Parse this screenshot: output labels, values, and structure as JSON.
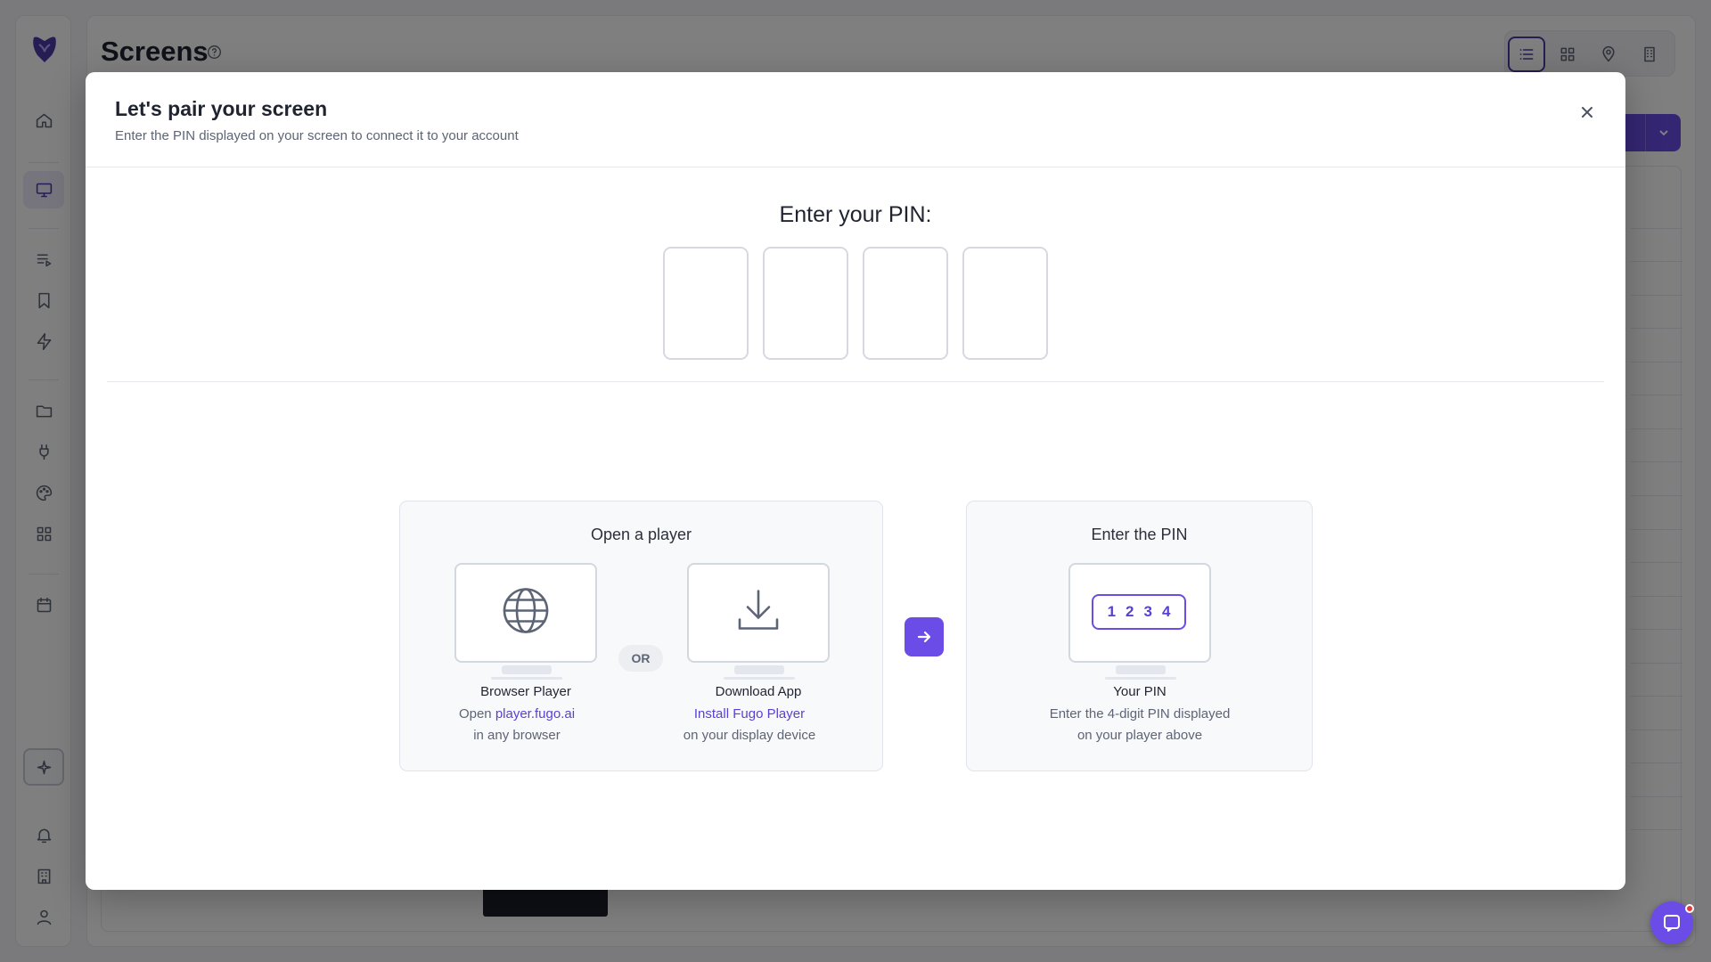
{
  "app": {
    "page_title": "Screens"
  },
  "modal": {
    "title": "Let's pair your screen",
    "subtitle": "Enter the PIN displayed on your screen to connect it to your account",
    "pin_heading": "Enter your PIN:",
    "pin_digits": [
      "",
      "",
      "",
      ""
    ]
  },
  "open_player_card": {
    "title": "Open a player",
    "or_label": "OR",
    "browser": {
      "label": "Browser Player",
      "line1_prefix": "Open ",
      "line1_link": "player.fugo.ai",
      "line2": "in any browser",
      "icon": "globe-icon"
    },
    "download": {
      "label": "Download App",
      "link": "Install Fugo Player",
      "line2": "on your display device",
      "icon": "download-icon"
    }
  },
  "enter_pin_card": {
    "title": "Enter the PIN",
    "sample_digits": [
      "1",
      "2",
      "3",
      "4"
    ],
    "label": "Your PIN",
    "line1": "Enter the 4-digit PIN displayed",
    "line2": "on your player above"
  },
  "colors": {
    "accent": "#6b4ce6",
    "link": "#5b3fd4",
    "overlay": "rgba(0,0,0,0.5)"
  }
}
